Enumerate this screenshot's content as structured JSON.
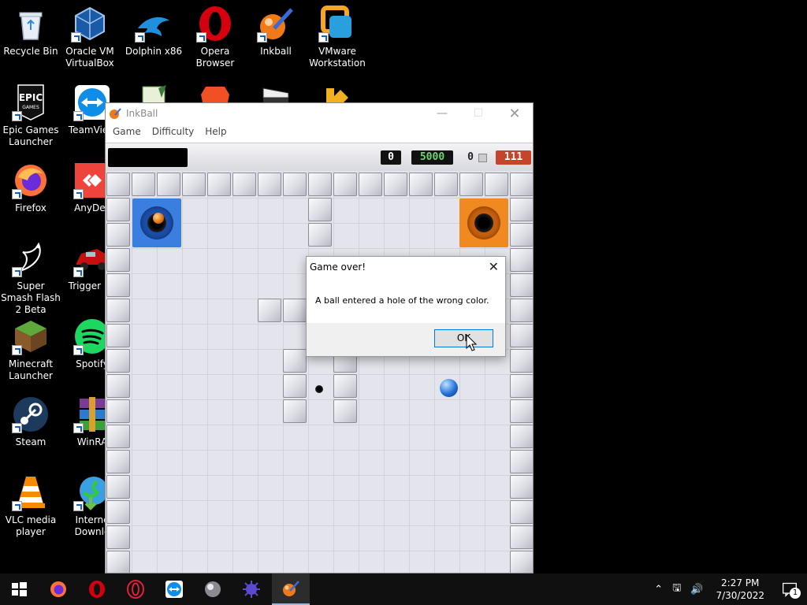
{
  "desktop": {
    "icons": [
      {
        "label": "Recycle Bin",
        "icon": "recycle-bin-icon"
      },
      {
        "label": "Oracle VM VirtualBox",
        "icon": "virtualbox-icon"
      },
      {
        "label": "Dolphin x86",
        "icon": "dolphin-icon"
      },
      {
        "label": "Opera Browser",
        "icon": "opera-icon"
      },
      {
        "label": "Inkball",
        "icon": "inkball-icon"
      },
      {
        "label": "VMware Workstation",
        "icon": "vmware-icon"
      },
      {
        "label": "Epic Games Launcher",
        "icon": "epic-games-icon"
      },
      {
        "label": "TeamView",
        "icon": "teamviewer-icon"
      },
      {
        "label": "Firefox",
        "icon": "firefox-icon"
      },
      {
        "label": "AnyDes",
        "icon": "anydesk-icon"
      },
      {
        "label": "Super Smash Flash 2 Beta",
        "icon": "super-smash-flash-icon"
      },
      {
        "label": "Trigger Ra",
        "icon": "trigger-rally-icon"
      },
      {
        "label": "Minecraft Launcher",
        "icon": "minecraft-icon"
      },
      {
        "label": "Spotify",
        "icon": "spotify-icon"
      },
      {
        "label": "Steam",
        "icon": "steam-icon"
      },
      {
        "label": "WinRA",
        "icon": "winrar-icon"
      },
      {
        "label": "VLC media player",
        "icon": "vlc-icon"
      },
      {
        "label": "Interne Downlo",
        "icon": "internet-download-manager-icon"
      }
    ],
    "epic_logo_text": "EPIC GAMES"
  },
  "window": {
    "title": "InkBall",
    "menu": [
      "Game",
      "Difficulty",
      "Help"
    ],
    "scores": {
      "balls_scored": "0",
      "points": "5000",
      "balls_remaining": "0",
      "timer": "111"
    }
  },
  "dialog": {
    "title": "Game over!",
    "message": "A ball entered a hole of the wrong color.",
    "ok_label": "OK"
  },
  "taskbar": {
    "apps": [
      "start-icon",
      "firefox-icon",
      "opera-icon",
      "opera-gx-icon",
      "teamviewer-icon",
      "marble-icon",
      "purple-game-icon",
      "inkball-icon"
    ],
    "time": "2:27 PM",
    "date": "7/30/2022",
    "notification_count": "1"
  },
  "colors": {
    "blue_hole": "#3a7fe0",
    "orange_hole": "#f08a20",
    "timer_bg": "#c4452b",
    "points_text": "#6ed66e"
  }
}
